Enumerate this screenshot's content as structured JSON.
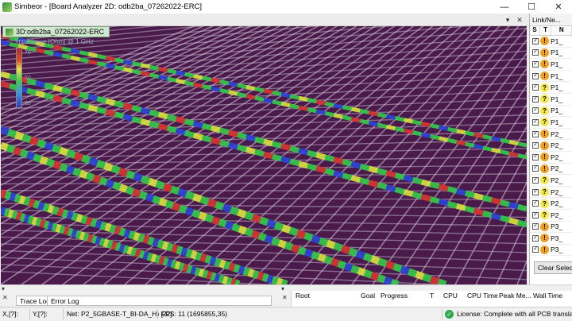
{
  "window": {
    "title": "Simbeor - [Board Analyzer 2D: odb2ba_07262022-ERC]",
    "min_glyph": "—",
    "max_glyph": "☐",
    "close_glyph": "✕"
  },
  "tabbar": {
    "pin_glyph": "▾",
    "close_glyph": "✕"
  },
  "viewport": {
    "tab_label": "3D:odb2ba_07262022-ERC",
    "legend_title": "Impedance [Ohm] @ 1 GHz",
    "legend_ticks": [
      "70",
      "50",
      "30"
    ],
    "colors": {
      "background": "#4a1a4a",
      "grid": "#d6cde0",
      "trace_red": "#d63434",
      "trace_green": "#33c74a",
      "trace_blue": "#2f44d6",
      "trace_yellow": "#d8e040"
    }
  },
  "right_panel": {
    "tab_label": "Link/Ne...",
    "headers": [
      "S",
      "T",
      "N"
    ],
    "rows": [
      {
        "status": "warn",
        "glyph": "!",
        "name": "P1_"
      },
      {
        "status": "warn",
        "glyph": "!",
        "name": "P1_"
      },
      {
        "status": "warn",
        "glyph": "!",
        "name": "P1_"
      },
      {
        "status": "warn",
        "glyph": "!",
        "name": "P1_"
      },
      {
        "status": "q",
        "glyph": "?",
        "name": "P1_"
      },
      {
        "status": "q",
        "glyph": "?",
        "name": "P1_"
      },
      {
        "status": "q",
        "glyph": "?",
        "name": "P1_"
      },
      {
        "status": "q",
        "glyph": "?",
        "name": "P1_"
      },
      {
        "status": "warn",
        "glyph": "!",
        "name": "P2_"
      },
      {
        "status": "warn",
        "glyph": "!",
        "name": "P2_"
      },
      {
        "status": "warn",
        "glyph": "!",
        "name": "P2_"
      },
      {
        "status": "warn",
        "glyph": "!",
        "name": "P2_"
      },
      {
        "status": "q",
        "glyph": "?",
        "name": "P2_"
      },
      {
        "status": "q",
        "glyph": "?",
        "name": "P2_"
      },
      {
        "status": "q",
        "glyph": "?",
        "name": "P2_"
      },
      {
        "status": "q",
        "glyph": "?",
        "name": "P2_"
      },
      {
        "status": "warn",
        "glyph": "!",
        "name": "P3_"
      },
      {
        "status": "warn",
        "glyph": "!",
        "name": "P3_"
      },
      {
        "status": "warn",
        "glyph": "!",
        "name": "P3_"
      }
    ],
    "clear_button": "Clear Selectio"
  },
  "bottom": {
    "close_glyph": "✕",
    "pin_glyph": "▾",
    "tabs": [
      "Trace Log",
      "Error Log"
    ],
    "jobs_columns": [
      "Root",
      "Goal",
      "Progress",
      "T",
      "CPU",
      "CPU Time",
      "Peak Me...",
      "Wall Time"
    ]
  },
  "status": {
    "x": "X,[?]:",
    "y": "Y,[?]:",
    "net": "Net: P2_5GBASE-T_BI-DA_H) [22]",
    "fps": "FPS: 11 (1695855,35)",
    "license": "License: Complete with all PCB translators"
  }
}
